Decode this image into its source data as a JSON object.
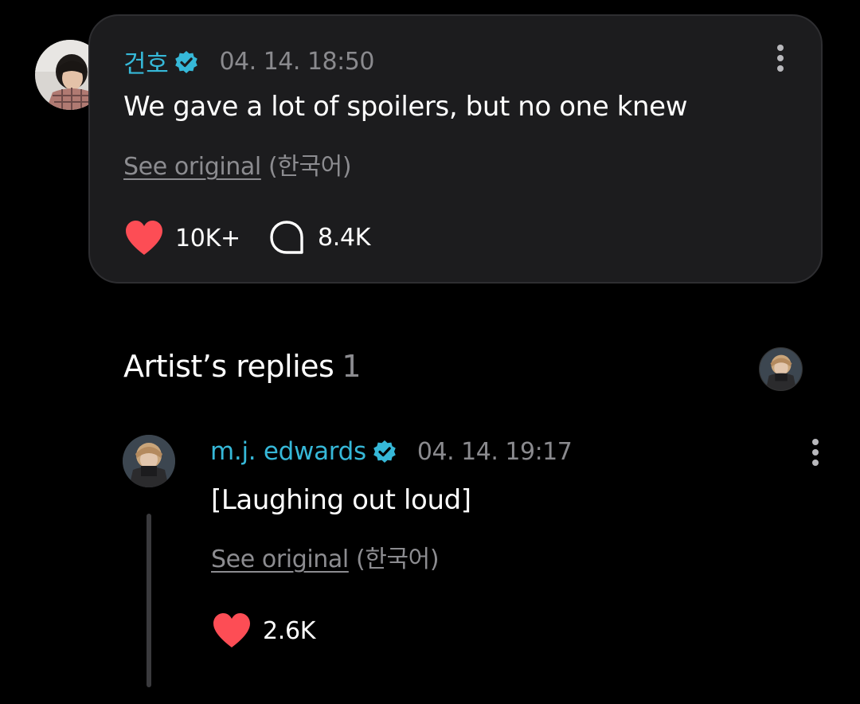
{
  "comment": {
    "author": "건호",
    "timestamp": "04. 14. 18:50",
    "text": "We gave a lot of spoilers, but no one knew",
    "see_original_link": "See original",
    "see_original_lang": "(한국어)",
    "likes": "10K+",
    "replies": "8.4K"
  },
  "artist_replies": {
    "title": "Artist’s replies",
    "count": "1"
  },
  "reply": {
    "author": "m.j. edwards",
    "timestamp": "04. 14. 19:17",
    "text": "[Laughing out loud]",
    "see_original_link": "See original",
    "see_original_lang": "(한국어)",
    "likes": "2.6K"
  },
  "icons": {
    "verified": "verified-badge-icon",
    "heart": "heart-icon",
    "comment": "comment-bubble-icon",
    "more": "more-vertical-icon"
  },
  "colors": {
    "background": "#000000",
    "card": "#1c1c1e",
    "accent_name": "#36b8d8",
    "heart": "#fd4d55",
    "muted_text": "#8a8a8e"
  }
}
